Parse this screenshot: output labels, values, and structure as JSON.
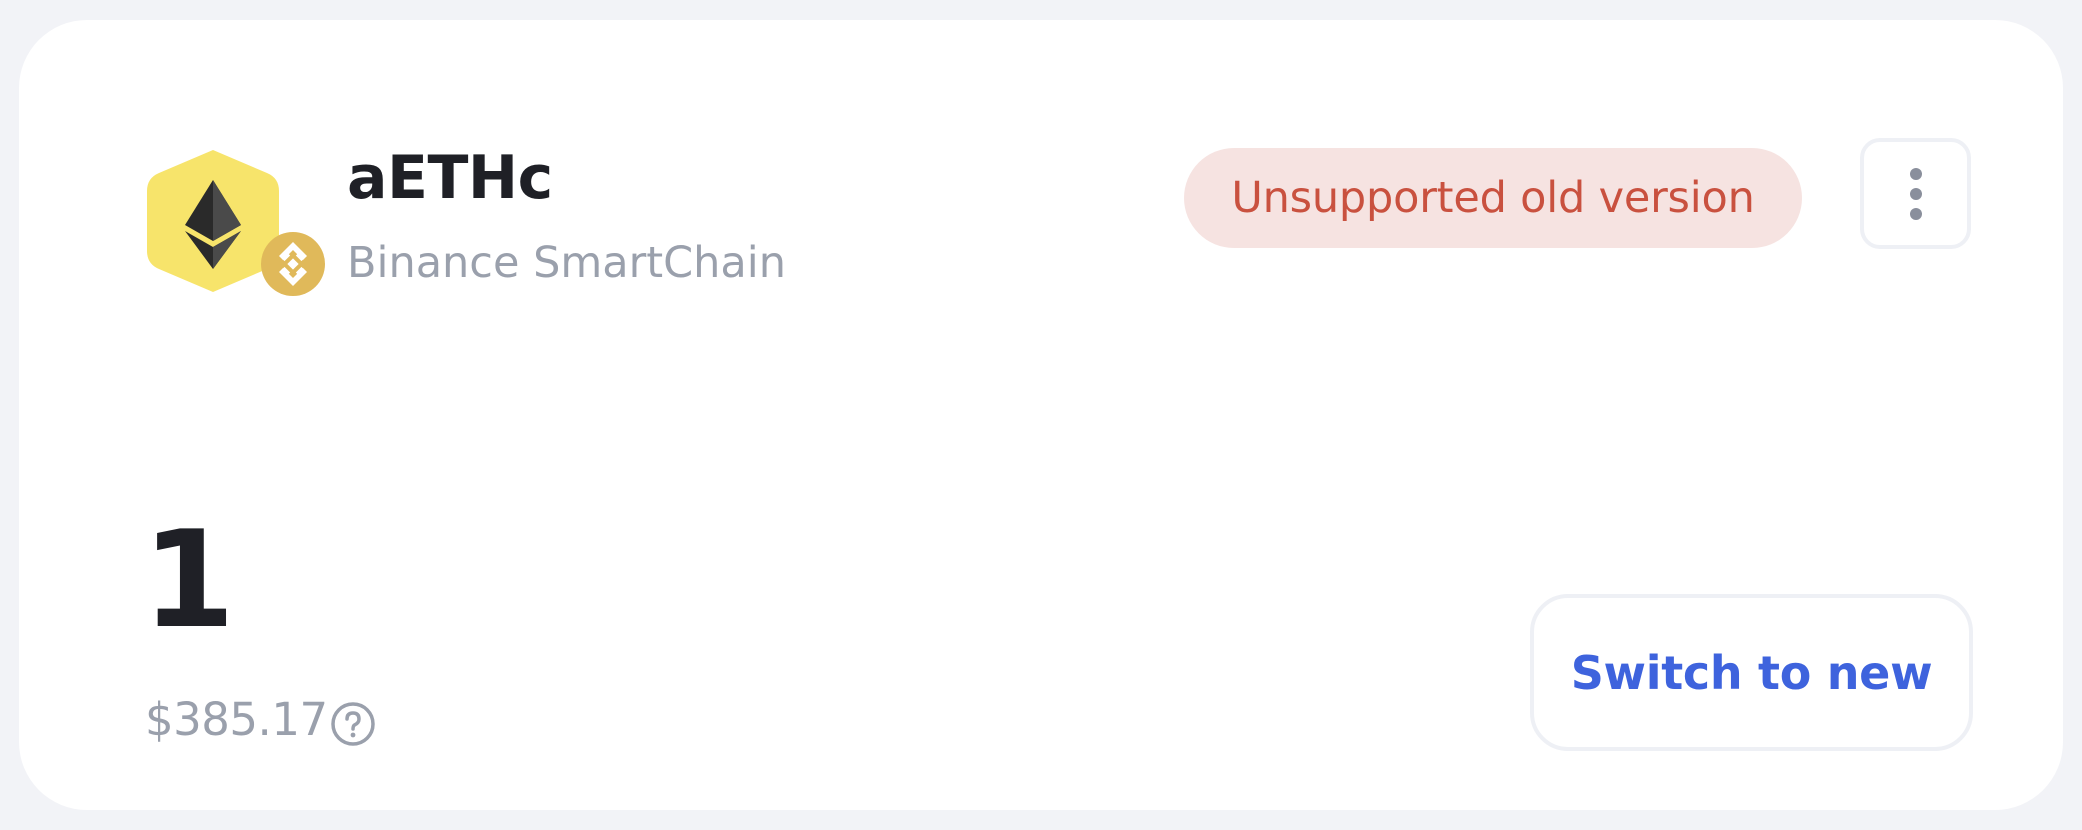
{
  "token": {
    "symbol": "aETHc",
    "network": "Binance SmartChain",
    "icon": "ethereum-icon",
    "network_icon": "binance-icon"
  },
  "status": {
    "badge_label": "Unsupported old version"
  },
  "menu": {
    "icon": "more-vertical-icon"
  },
  "balance": {
    "amount": "1",
    "usd_value": "$385.17",
    "help_icon": "question-circle-icon"
  },
  "actions": {
    "switch_label": "Switch to new"
  },
  "colors": {
    "page_background": "#f2f3f7",
    "card_background": "#ffffff",
    "badge_background": "#f6e3e1",
    "badge_text": "#c9513f",
    "accent": "#3e63dd",
    "muted_text": "#9aa0ac",
    "token_hexagon": "#f7e46b",
    "network_badge": "#e0b95a"
  }
}
